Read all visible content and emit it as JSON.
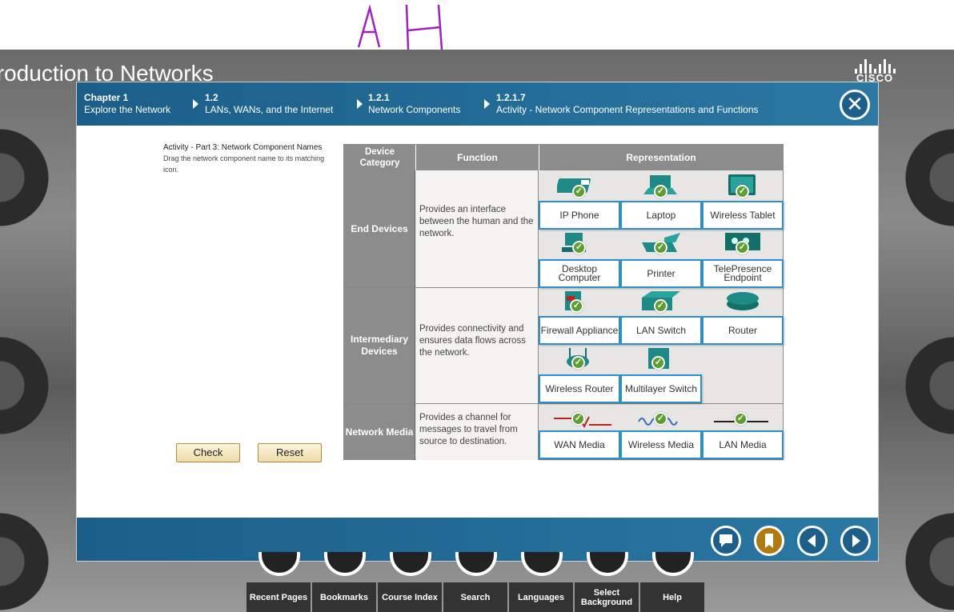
{
  "annotation_text": "A H",
  "course_title": "troduction to Networks",
  "brand": "CISCO",
  "breadcrumbs": [
    {
      "level": "Chapter 1",
      "title": "Explore the Network"
    },
    {
      "level": "1.2",
      "title": "LANs, WANs, and the Internet"
    },
    {
      "level": "1.2.1",
      "title": "Network Components"
    },
    {
      "level": "1.2.1.7",
      "title": "Activity - Network Component Representations and Functions"
    }
  ],
  "instructions": {
    "title": "Activity - Part 3: Network Component Names",
    "body": "Drag the network component name to its matching icon."
  },
  "buttons": {
    "check": "Check",
    "reset": "Reset"
  },
  "table": {
    "headers": {
      "category": "Device Category",
      "function": "Function",
      "representation": "Representation"
    },
    "rows": [
      {
        "category": "End Devices",
        "function": "Provides an interface between the human and the network.",
        "items": [
          "IP Phone",
          "Laptop",
          "Wireless Tablet",
          "Desktop Computer",
          "Printer",
          "TelePresence Endpoint"
        ]
      },
      {
        "category": "Intermediary Devices",
        "function": "Provides connectivity and ensures data flows across the network.",
        "items": [
          "Firewall Appliance",
          "LAN Switch",
          "Router",
          "Wireless Router",
          "Multilayer Switch"
        ]
      },
      {
        "category": "Network Media",
        "function": "Provides a channel for messages to travel from source to destination.",
        "items": [
          "WAN Media",
          "Wireless Media",
          "LAN Media"
        ]
      }
    ]
  },
  "dock": [
    {
      "label": "Recent Pages"
    },
    {
      "label": "Bookmarks"
    },
    {
      "label": "Course Index"
    },
    {
      "label": "Search"
    },
    {
      "label": "Languages"
    },
    {
      "label": "Select Background"
    },
    {
      "label": "Help"
    }
  ],
  "colors": {
    "accent_blue": "#1b5e89",
    "chip_border": "#2e90c8",
    "check_green": "#5c9e2f",
    "icon_teal": "#1d8a85",
    "annotation_purple": "#a020c0"
  }
}
